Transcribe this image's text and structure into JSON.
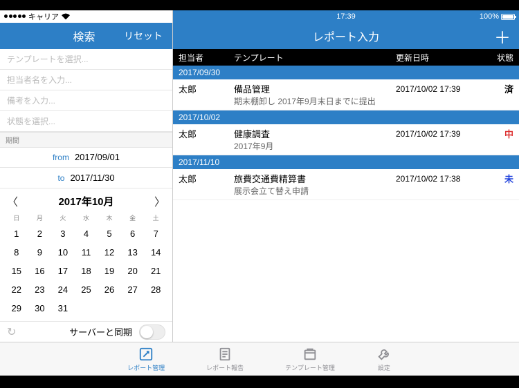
{
  "status": {
    "carrier": "キャリア",
    "time": "17:39",
    "battery": "100%"
  },
  "left": {
    "search": "検索",
    "reset": "リセット",
    "filters": {
      "template": "テンプレートを選択...",
      "assignee": "担当者名を入力...",
      "remarks": "備考を入力...",
      "status": "状態を選択..."
    },
    "period_label": "期間",
    "from_label": "from",
    "from_value": "2017/09/01",
    "to_label": "to",
    "to_value": "2017/11/30",
    "calendar": {
      "month": "2017年10月",
      "dow": [
        "日",
        "月",
        "火",
        "水",
        "木",
        "金",
        "土"
      ],
      "weeks": [
        [
          "1",
          "2",
          "3",
          "4",
          "5",
          "6",
          "7"
        ],
        [
          "8",
          "9",
          "10",
          "11",
          "12",
          "13",
          "14"
        ],
        [
          "15",
          "16",
          "17",
          "18",
          "19",
          "20",
          "21"
        ],
        [
          "22",
          "23",
          "24",
          "25",
          "26",
          "27",
          "28"
        ],
        [
          "29",
          "30",
          "31",
          "",
          "",
          "",
          ""
        ]
      ]
    },
    "sync_label": "サーバーと同期"
  },
  "right": {
    "title": "レポート入力",
    "cols": {
      "assignee": "担当者",
      "template": "テンプレート",
      "updated": "更新日時",
      "status": "状態"
    },
    "groups": [
      {
        "date": "2017/09/30",
        "row": {
          "assignee": "太郎",
          "template": "備品管理",
          "updated": "2017/10/02 17:39",
          "status": "済",
          "cls": "st-done"
        },
        "sub": "期末棚卸し 2017年9月末日までに提出"
      },
      {
        "date": "2017/10/02",
        "row": {
          "assignee": "太郎",
          "template": "健康調査",
          "updated": "2017/10/02 17:39",
          "status": "中",
          "cls": "st-mid"
        },
        "sub": "2017年9月"
      },
      {
        "date": "2017/11/10",
        "row": {
          "assignee": "太郎",
          "template": "旅費交通費精算書",
          "updated": "2017/10/02 17:38",
          "status": "未",
          "cls": "st-not"
        },
        "sub": "展示会立て替え申請"
      }
    ]
  },
  "tabs": {
    "manage": "レポート管理",
    "report": "レポート報告",
    "template": "テンプレート管理",
    "settings": "設定"
  }
}
